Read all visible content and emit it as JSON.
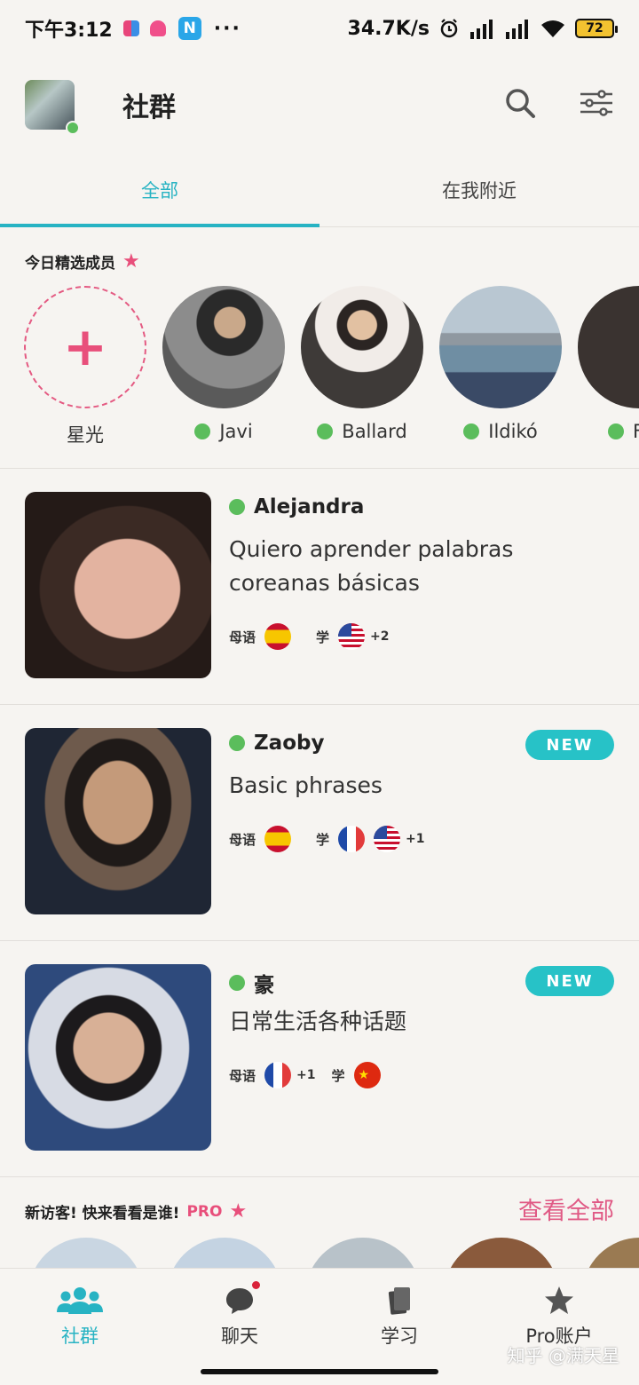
{
  "status_bar": {
    "time": "下午3:12",
    "network_speed": "34.7K/s",
    "battery": "72"
  },
  "header": {
    "title": "社群"
  },
  "tabs": [
    {
      "label": "全部",
      "active": true
    },
    {
      "label": "在我附近",
      "active": false
    }
  ],
  "featured": {
    "label": "今日精选成员",
    "add_label": "星光",
    "members": [
      {
        "name": "Javi"
      },
      {
        "name": "Ballard"
      },
      {
        "name": "Ildikó"
      },
      {
        "name": "F"
      }
    ]
  },
  "cards": [
    {
      "name": "Alejandra",
      "description": "Quiero aprender palabras coreanas básicas",
      "native_label": "母语",
      "learn_label": "学",
      "native_flags": [
        "es"
      ],
      "learn_flags": [
        "us"
      ],
      "learn_extra": "+2",
      "is_new": false
    },
    {
      "name": "Zaoby",
      "description": "Basic phrases",
      "native_label": "母语",
      "learn_label": "学",
      "native_flags": [
        "es"
      ],
      "learn_flags": [
        "fr",
        "us"
      ],
      "learn_extra": "+1",
      "badge": "NEW",
      "is_new": true
    },
    {
      "name": "豪",
      "description": "日常生活各种话题",
      "native_label": "母语",
      "learn_label": "学",
      "native_flags": [
        "fr"
      ],
      "native_extra": "+1",
      "learn_flags": [
        "cn"
      ],
      "badge": "NEW",
      "is_new": true
    }
  ],
  "visitors": {
    "label": "新访客! 快来看看是谁!",
    "pro": "PRO",
    "view_all": "查看全部"
  },
  "bottom_nav": [
    {
      "label": "社群",
      "icon": "community-icon",
      "active": true
    },
    {
      "label": "聊天",
      "icon": "chat-icon",
      "active": false,
      "has_badge": true
    },
    {
      "label": "学习",
      "icon": "learn-icon",
      "active": false
    },
    {
      "label": "Pro账户",
      "icon": "star-icon",
      "active": false
    }
  ],
  "watermark": "知乎 @满天星",
  "colors": {
    "accent": "#27b3c3",
    "pink": "#e84f7b",
    "online": "#5bbd5c",
    "new_badge": "#27c2c7"
  }
}
